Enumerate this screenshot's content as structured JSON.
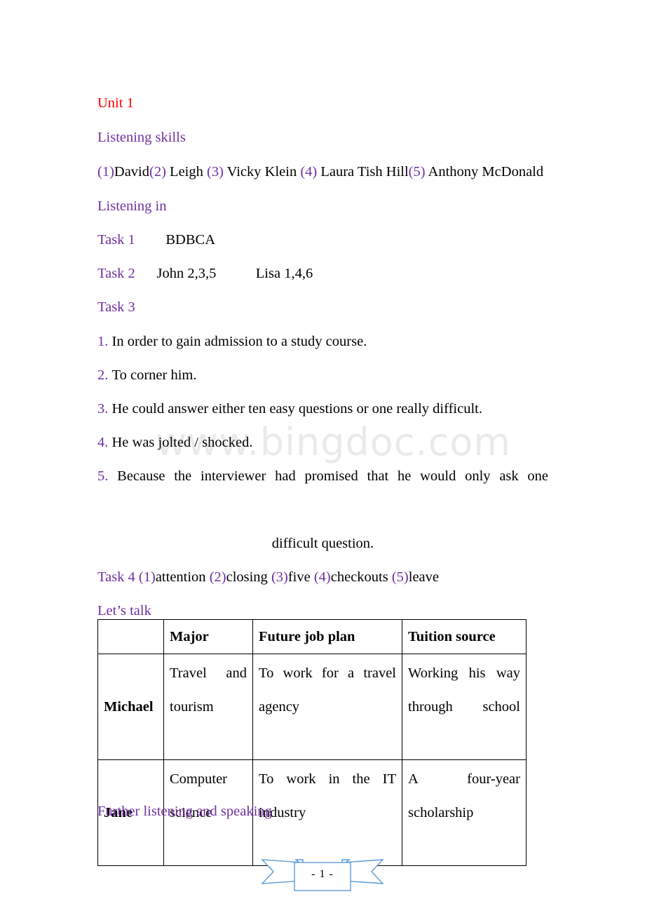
{
  "document": {
    "watermark": "www.bingdoc.com",
    "unit_title": "Unit 1",
    "colors": {
      "heading_purple": "#7030A0",
      "unit_red": "#FF0000",
      "body_black": "#000000",
      "ribbon_blue": "#5B9BD5",
      "watermark_gray": "#EAEAEA"
    }
  },
  "sections": {
    "listening_skills": {
      "heading": "Listening skills",
      "answers": [
        {
          "marker": "(1)",
          "text": "David"
        },
        {
          "marker": "(2)",
          "text": " Leigh "
        },
        {
          "marker": "(3)",
          "text": " Vicky Klein "
        },
        {
          "marker": "(4)",
          "text": " Laura Tish Hill"
        },
        {
          "marker": "(5)",
          "text": " Anthony McDonald"
        }
      ],
      "line1": "(1)David(2) Leigh (3) Vicky Klein (4) Laura Tish Hill(5) Anthony",
      "line2": "McDonald"
    },
    "listening_in": {
      "heading": "Listening in",
      "task1": {
        "label": "Task 1",
        "answer": "BDBCA"
      },
      "task2": {
        "label": "Task 2",
        "answer_john": "John 2,3,5",
        "answer_lisa": "Lisa 1,4,6"
      },
      "task3": {
        "label": "Task 3",
        "items": [
          {
            "marker": "1.",
            "text": "In order to gain admission to a study course."
          },
          {
            "marker": "2.",
            "text": "To corner him."
          },
          {
            "marker": "3.",
            "text": "He could answer either ten easy questions or one really difficult."
          },
          {
            "marker": "4.",
            "text": "He was jolted / shocked."
          },
          {
            "marker": "5.",
            "text": "Because the interviewer had promised that he would only ask one",
            "continuation": "difficult question."
          }
        ]
      },
      "task4": {
        "label": "Task 4 ",
        "blanks": [
          {
            "marker": "(1)",
            "text": "attention "
          },
          {
            "marker": "(2)",
            "text": "closing "
          },
          {
            "marker": "(3)",
            "text": "five "
          },
          {
            "marker": "(4)",
            "text": "checkouts "
          },
          {
            "marker": "(5)",
            "text": "leave"
          }
        ]
      }
    },
    "lets_talk": {
      "heading": "Let’s talk",
      "table": {
        "columns": [
          "",
          "Major",
          "Future job plan",
          "Tuition source"
        ],
        "rows": [
          {
            "name": "Michael",
            "major": "Travel and tourism",
            "future_job_plan": "To work for a travel agency",
            "tuition_source": "Working his way through school"
          },
          {
            "name": "Jane",
            "major": "Computer science",
            "future_job_plan": "To work in the IT industry",
            "tuition_source": "A four-year scholarship"
          }
        ]
      }
    },
    "further": {
      "heading": "Further listening and speaking"
    }
  },
  "footer": {
    "page_number": "- 1 -"
  }
}
